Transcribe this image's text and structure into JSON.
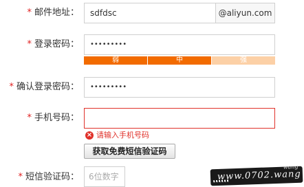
{
  "form": {
    "required_mark": "*",
    "email": {
      "label": "邮件地址：",
      "value": "sdfdsc",
      "domain": "@aliyun.com"
    },
    "password": {
      "label": "登录密码：",
      "value": "•••••••••"
    },
    "strength": {
      "levels": [
        "弱",
        "中",
        "强"
      ],
      "colors": [
        "#f26b00",
        "#f26b00",
        "#fcd0a6"
      ]
    },
    "confirm_password": {
      "label": "确认登录密码：",
      "value": "•••••••••"
    },
    "phone": {
      "label": "手机号码：",
      "value": "",
      "error_text": "请输入手机号码",
      "error_icon": "×",
      "error_color": "#e0312a"
    },
    "sms_button": {
      "label": "获取免费短信验证码"
    },
    "sms_code": {
      "label": "短信验证码：",
      "placeholder": "6位数字"
    }
  },
  "watermark": {
    "text": "www.0702.wang",
    "sup": "wang"
  }
}
